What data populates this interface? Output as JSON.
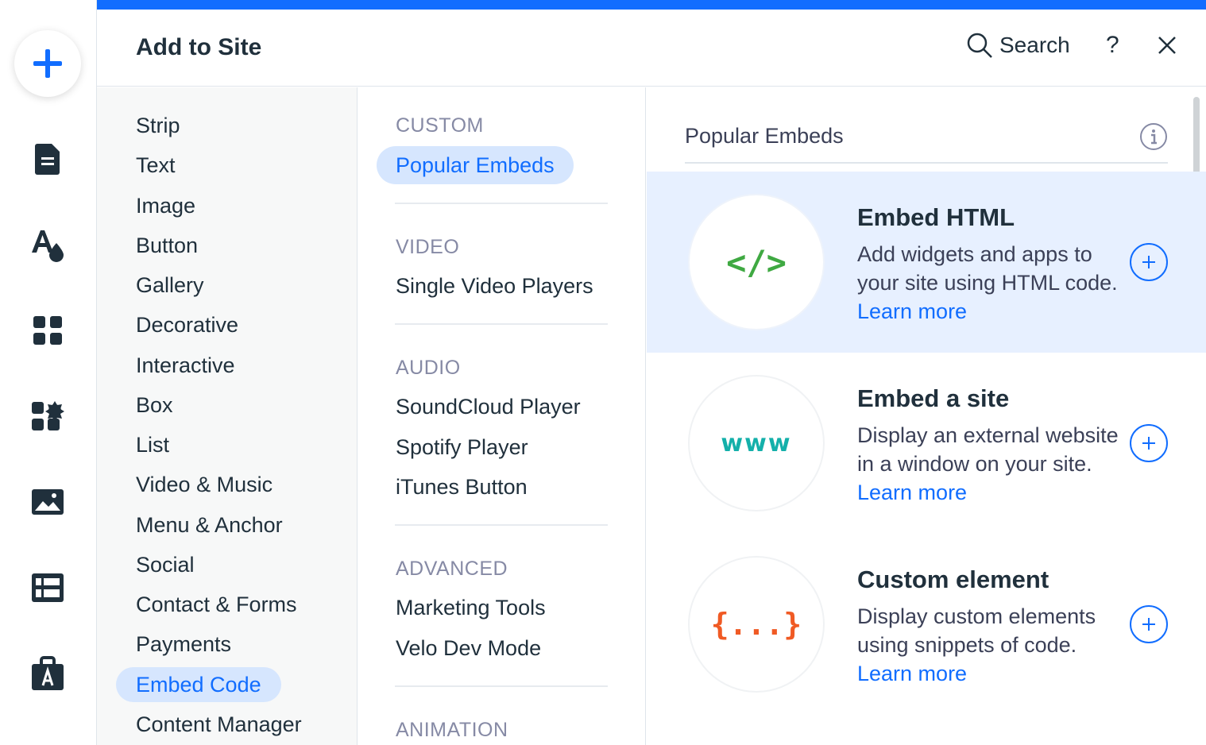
{
  "header": {
    "title": "Add to Site",
    "search_label": "Search",
    "help_label": "?"
  },
  "rail": {
    "icons": [
      "plus-icon",
      "pages-icon",
      "design-icon",
      "apps-icon",
      "business-icon",
      "media-icon",
      "cms-icon",
      "market-icon"
    ]
  },
  "categories": [
    "Strip",
    "Text",
    "Image",
    "Button",
    "Gallery",
    "Decorative",
    "Interactive",
    "Box",
    "List",
    "Video & Music",
    "Menu & Anchor",
    "Social",
    "Contact & Forms",
    "Payments",
    "Embed Code",
    "Content Manager"
  ],
  "active_category": "Embed Code",
  "subsections": {
    "custom": {
      "heading": "CUSTOM",
      "items": [
        "Popular Embeds"
      ]
    },
    "video": {
      "heading": "VIDEO",
      "items": [
        "Single Video Players"
      ]
    },
    "audio": {
      "heading": "AUDIO",
      "items": [
        "SoundCloud Player",
        "Spotify Player",
        "iTunes Button"
      ]
    },
    "advanced": {
      "heading": "ADVANCED",
      "items": [
        "Marketing Tools",
        "Velo Dev Mode"
      ]
    },
    "animation": {
      "heading": "ANIMATION"
    }
  },
  "content": {
    "title": "Popular Embeds",
    "cards": [
      {
        "title": "Embed HTML",
        "desc": "Add widgets and apps to your site using HTML code.",
        "link": "Learn more",
        "glyph": "</>",
        "glyph_color": "#3fa942"
      },
      {
        "title": "Embed a site",
        "desc": "Display an external website in a window on your site.",
        "link": "Learn more",
        "glyph": "www",
        "glyph_color": "#14b0aa"
      },
      {
        "title": "Custom element",
        "desc": "Display custom elements using snippets of code.",
        "link": "Learn more",
        "glyph": "{...}",
        "glyph_color": "#f05a24"
      }
    ]
  },
  "colors": {
    "accent": "#116dff",
    "selected_bg": "#d6e6fe",
    "card_highlight": "#e7f0ff"
  }
}
